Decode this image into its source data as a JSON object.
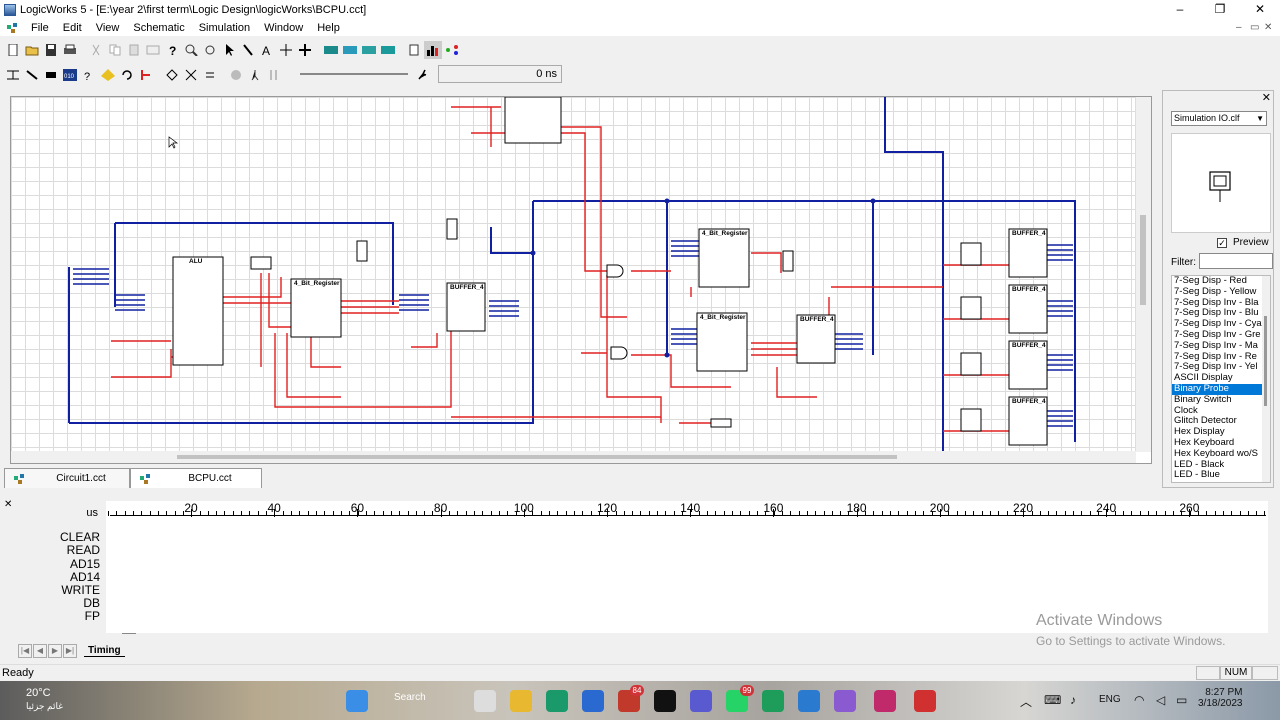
{
  "window": {
    "title": "LogicWorks 5 - [E:\\year 2\\first term\\Logic Design\\logicWorks\\BCPU.cct]",
    "controls": [
      "–",
      "❐",
      "✕"
    ]
  },
  "menu": {
    "items": [
      "File",
      "Edit",
      "View",
      "Schematic",
      "Simulation",
      "Window",
      "Help"
    ],
    "mdi_controls": [
      "–",
      "▭",
      "✕"
    ]
  },
  "toolbar2": {
    "time_display": "0 ns"
  },
  "schematic": {
    "components": [
      {
        "label": "ALU"
      },
      {
        "label": "4_Bit_Register"
      },
      {
        "label": "BUFFER_4"
      },
      {
        "label": "4_Bit_Register"
      },
      {
        "label": "4_Bit_Register"
      },
      {
        "label": "BUFFER_4"
      },
      {
        "label": "BUFFER_4"
      },
      {
        "label": "BUFFER_4"
      },
      {
        "label": "BUFFER_4"
      },
      {
        "label": "BUFFER_4"
      }
    ]
  },
  "doc_tabs": [
    {
      "label": "Circuit1.cct"
    },
    {
      "label": "BCPU.cct"
    }
  ],
  "parts_panel": {
    "library": "Simulation IO.clf",
    "preview_label": "Preview",
    "preview_checked": true,
    "filter_label": "Filter:",
    "filter_value": "",
    "items": [
      "7-Seg Disp - Red",
      "7-Seg Disp - Yellow",
      "7-Seg Disp Inv - Bla",
      "7-Seg Disp Inv - Blu",
      "7-Seg Disp Inv - Cya",
      "7-Seg Disp Inv - Gre",
      "7-Seg Disp Inv - Ma",
      "7-Seg Disp Inv - Re",
      "7-Seg Disp Inv - Yel",
      "ASCII Display",
      "Binary Probe",
      "Binary Switch",
      "Clock",
      "Glitch Detector",
      "Hex Display",
      "Hex Keyboard",
      "Hex Keyboard wo/S",
      "LED - Black",
      "LED - Blue"
    ],
    "selected_index": 10
  },
  "timing": {
    "unit": "us",
    "signals": [
      "CLEAR",
      "READ",
      "AD15",
      "AD14",
      "WRITE",
      "DB",
      "FP"
    ],
    "ruler_labels": [
      "20",
      "40",
      "60",
      "80",
      "100",
      "120",
      "140",
      "160",
      "180",
      "200",
      "220",
      "240",
      "260"
    ],
    "tab_label": "Timing"
  },
  "status": {
    "ready": "Ready",
    "num": "NUM"
  },
  "watermark": {
    "line1": "Activate Windows",
    "line2": "Go to Settings to activate Windows."
  },
  "taskbar": {
    "temp": "20°C",
    "weather_text": "غائم جزئيا",
    "search": "Search",
    "badge_a": "84",
    "badge_b": "99",
    "lang": "ENG",
    "time": "8:27 PM",
    "date": "3/18/2023"
  },
  "colors": {
    "wire_red": "#e02020",
    "bus_blue": "#1020a0",
    "selection": "#0078d7"
  }
}
